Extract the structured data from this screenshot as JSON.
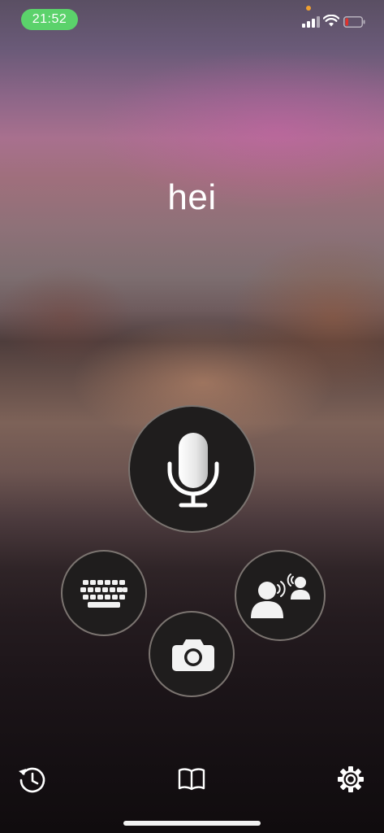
{
  "status_bar": {
    "time": "21:52",
    "battery_level": 0.1,
    "signal_bars": 4,
    "accent_time_bg": "#5bd26b",
    "battery_color": "#e0322c"
  },
  "main": {
    "recognized_text": "hei"
  },
  "icons": {
    "mic": "microphone-icon",
    "keyboard": "keyboard-icon",
    "conversation": "conversation-icon",
    "camera": "camera-icon",
    "history": "history-icon",
    "phrasebook": "book-icon",
    "settings": "gear-icon"
  }
}
